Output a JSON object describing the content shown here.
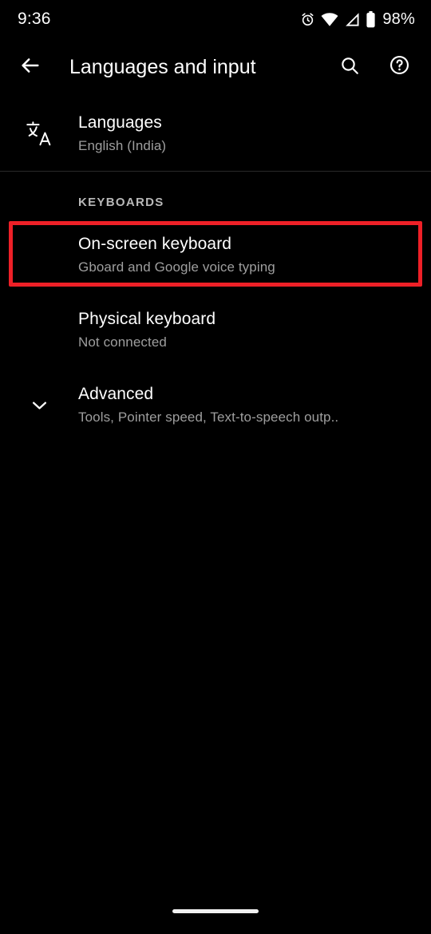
{
  "status_bar": {
    "clock": "9:36",
    "battery_percent": "98%",
    "icons": [
      "alarm-icon",
      "wifi-icon",
      "cellular-signal-icon",
      "battery-icon"
    ]
  },
  "toolbar": {
    "back_icon": "back-arrow-icon",
    "title": "Languages and input",
    "search_icon": "search-icon",
    "help_icon": "help-circle-icon"
  },
  "content": {
    "languages_row": {
      "icon": "translate-icon",
      "title": "Languages",
      "summary": "English (India)"
    },
    "keyboards_section": {
      "header": "KEYBOARDS",
      "rows": [
        {
          "title": "On-screen keyboard",
          "summary": "Gboard and Google voice typing",
          "highlighted": true
        },
        {
          "title": "Physical keyboard",
          "summary": "Not connected",
          "highlighted": false
        }
      ]
    },
    "advanced_row": {
      "icon": "chevron-down-icon",
      "title": "Advanced",
      "summary": "Tools, Pointer speed, Text-to-speech outp.."
    }
  },
  "nav_bar": {
    "home_pill": "home-gesture-pill"
  },
  "colors": {
    "background": "#000000",
    "primary_text": "#ffffff",
    "secondary_text": "#9e9e9e",
    "highlight_red": "#ee2027",
    "divider": "#2a2a2a"
  }
}
